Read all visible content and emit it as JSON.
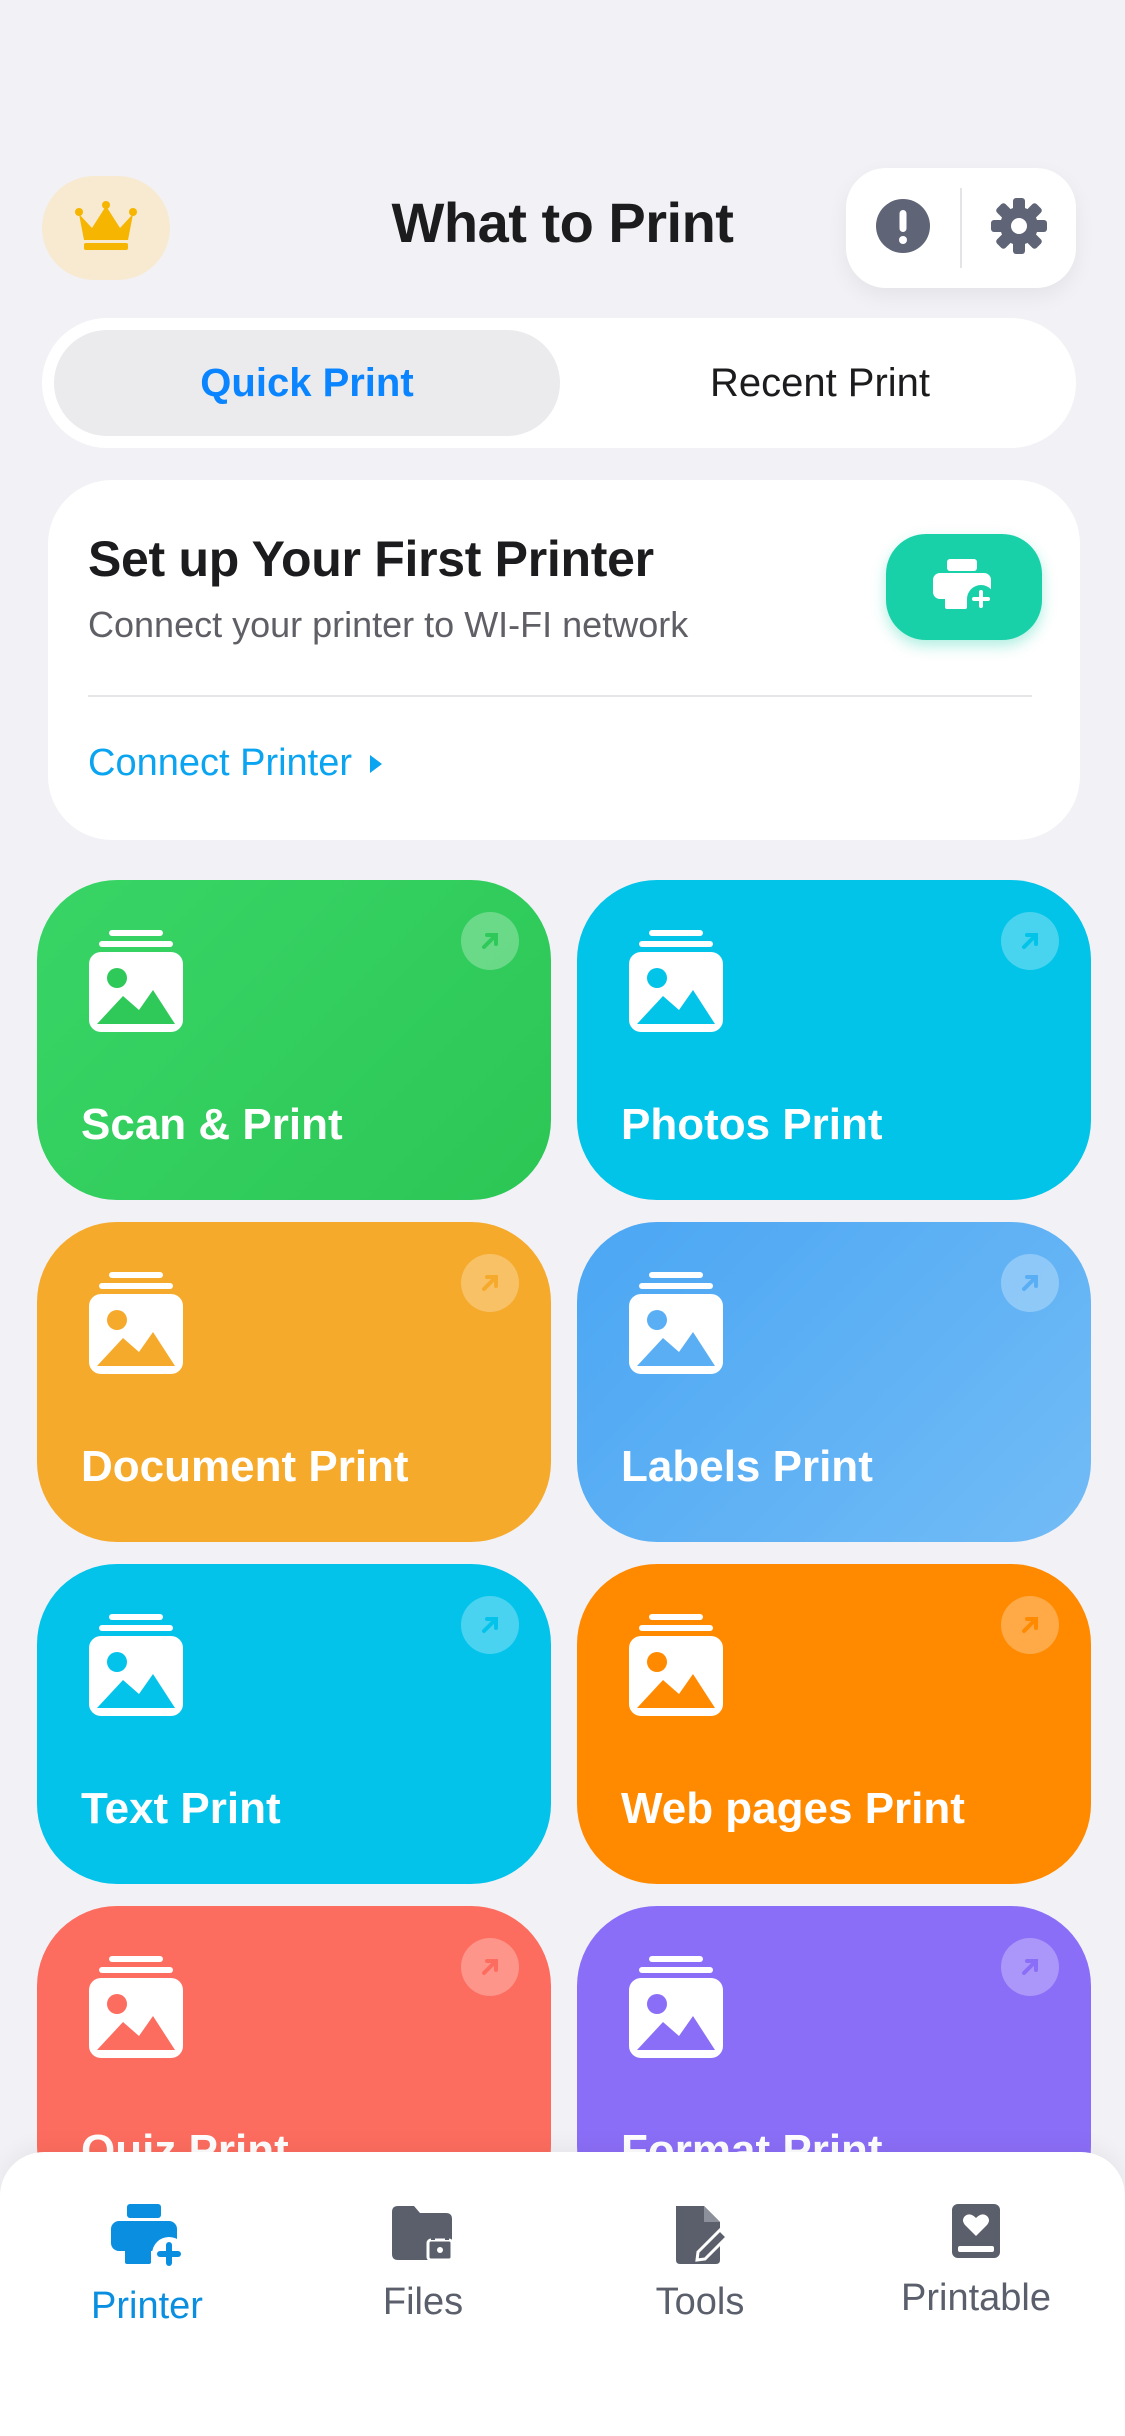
{
  "header": {
    "title": "What to Print",
    "crown_icon": "crown-icon",
    "info_icon": "info-icon",
    "settings_icon": "gear-icon"
  },
  "segmented": {
    "tabs": [
      {
        "label": "Quick Print",
        "active": true
      },
      {
        "label": "Recent Print",
        "active": false
      }
    ]
  },
  "setup": {
    "title": "Set up Your First Printer",
    "subtitle": "Connect your printer to WI-FI network",
    "link_label": "Connect Printer",
    "button_icon": "printer-add-icon"
  },
  "tiles": [
    {
      "label": "Scan & Print",
      "color": "#2fc95a"
    },
    {
      "label": "Photos Print",
      "color": "#02c3e8"
    },
    {
      "label": "Document Print",
      "color": "#f5aa2c"
    },
    {
      "label": "Labels Print",
      "color": "#5aaef4"
    },
    {
      "label": "Text Print",
      "color": "#04c3ea"
    },
    {
      "label": "Web pages Print",
      "color": "#ff8a00"
    },
    {
      "label": "Quiz Print",
      "color": "#fd6d5f"
    },
    {
      "label": "Format Print",
      "color": "#8b6ef7"
    }
  ],
  "tabbar": {
    "items": [
      {
        "label": "Printer",
        "icon": "printer-add-icon",
        "active": true
      },
      {
        "label": "Files",
        "icon": "folder-lock-icon",
        "active": false
      },
      {
        "label": "Tools",
        "icon": "document-edit-icon",
        "active": false
      },
      {
        "label": "Printable",
        "icon": "heart-book-icon",
        "active": false
      }
    ]
  },
  "colors": {
    "accent": "#0a84ff",
    "link": "#0aa4f0",
    "setup_button": "#19d1a8",
    "background": "#f2f2f6"
  }
}
